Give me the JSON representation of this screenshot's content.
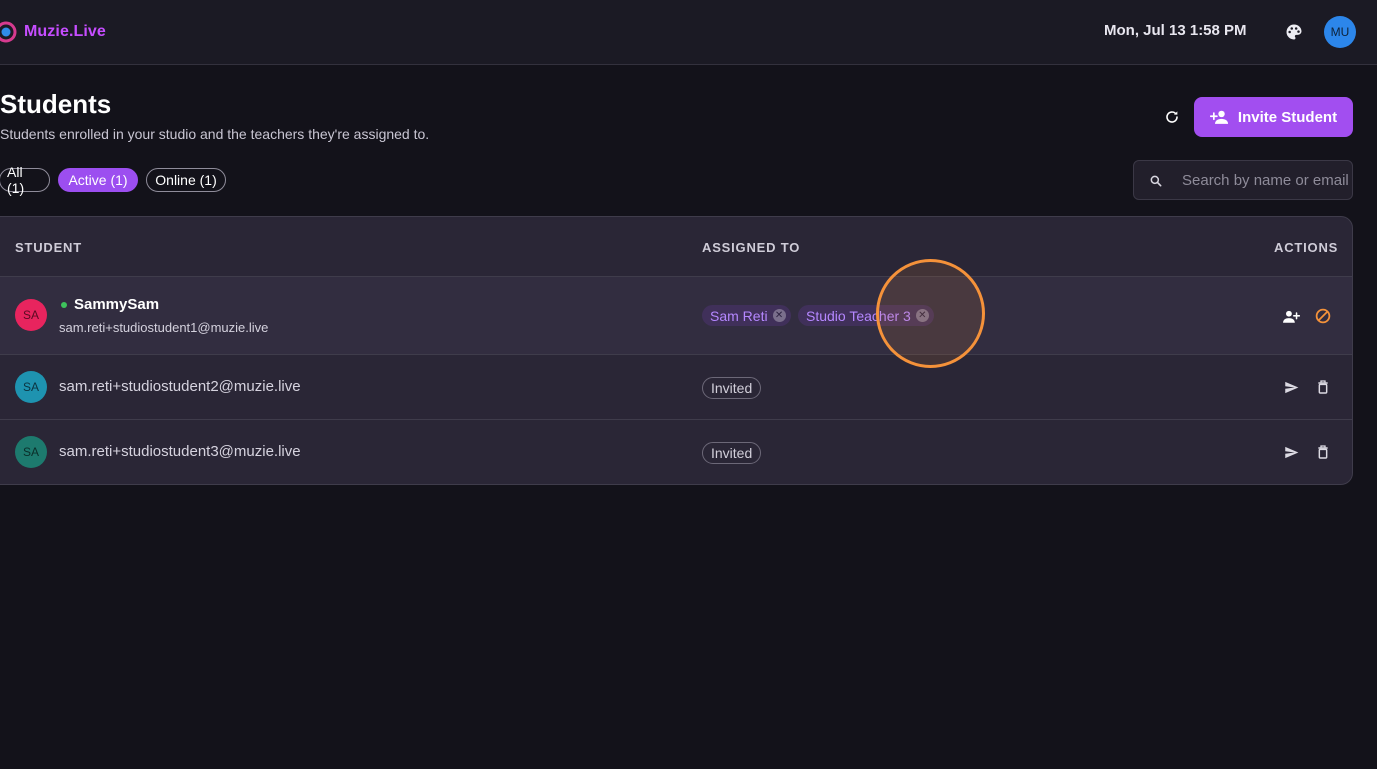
{
  "app": {
    "logo_text": "Muzie.Live",
    "datetime": "Mon, Jul 13 1:58 PM",
    "user_initials": "MU",
    "brand_color": "#a24ef0"
  },
  "icons": {
    "theme": "palette-icon",
    "refresh": "refresh-icon",
    "invite": "person-add-icon",
    "search": "search-icon",
    "assign": "person-add-icon",
    "block": "block-icon",
    "send": "send-icon",
    "delete": "trash-icon"
  },
  "header": {
    "title": "Students",
    "subtitle": "Students enrolled in your studio and the teachers they're assigned to.",
    "invite_label": "Invite Student"
  },
  "filters": [
    {
      "label": "All (1)",
      "active": false
    },
    {
      "label": "Active (1)",
      "active": true
    },
    {
      "label": "Online (1)",
      "active": false
    }
  ],
  "search": {
    "placeholder": "Search by name or email",
    "value": ""
  },
  "table": {
    "columns": [
      "STUDENT",
      "ASSIGNED TO",
      "ACTIONS"
    ],
    "rows": [
      {
        "initials": "SA",
        "avatar_color": "#e8245e",
        "online": true,
        "name": "SammySam",
        "email": "sam.reti+studiostudent1@muzie.live",
        "assigned": [
          "Sam Reti",
          "Studio Teacher 3"
        ],
        "actions": [
          "assign-teacher",
          "block"
        ]
      },
      {
        "initials": "SA",
        "avatar_color": "#1e93b0",
        "online": false,
        "email": "sam.reti+studiostudent2@muzie.live",
        "status": "Invited",
        "actions": [
          "resend-invite",
          "delete"
        ]
      },
      {
        "initials": "SA",
        "avatar_color": "#1d7a6e",
        "online": false,
        "email": "sam.reti+studiostudent3@muzie.live",
        "status": "Invited",
        "actions": [
          "resend-invite",
          "delete"
        ]
      }
    ]
  }
}
